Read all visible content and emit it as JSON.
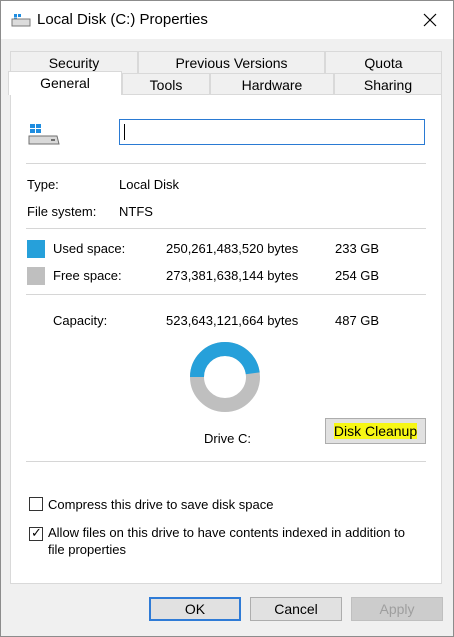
{
  "window": {
    "title": "Local Disk (C:) Properties"
  },
  "tabs": {
    "row_top": [
      "Security",
      "Previous Versions",
      "Quota"
    ],
    "row_bottom": [
      "General",
      "Tools",
      "Hardware",
      "Sharing"
    ],
    "active": "General"
  },
  "general": {
    "drive_label_value": "",
    "type_label": "Type:",
    "type_value": "Local Disk",
    "fs_label": "File system:",
    "fs_value": "NTFS",
    "used": {
      "label": "Used space:",
      "bytes": "250,261,483,520 bytes",
      "size": "233 GB",
      "color": "#26a0da"
    },
    "free": {
      "label": "Free space:",
      "bytes": "273,381,638,144 bytes",
      "size": "254 GB",
      "color": "#bfbfbf"
    },
    "capacity": {
      "label": "Capacity:",
      "bytes": "523,643,121,664 bytes",
      "size": "487 GB"
    },
    "usage_fraction": 0.478,
    "drive_caption": "Drive C:",
    "disk_cleanup_label": "Disk Cleanup",
    "compress_label": "Compress this drive to save disk space",
    "compress_checked": false,
    "index_label_line1": "Allow files on this drive to have contents indexed in addition to",
    "index_label_line2": "file properties",
    "index_checked": true
  },
  "footer": {
    "ok": "OK",
    "cancel": "Cancel",
    "apply": "Apply"
  },
  "icons": {
    "title": "drive-icon",
    "close": "close-icon",
    "drive": "windows-drive-icon"
  },
  "colors": {
    "accent": "#2f7bd6",
    "highlight": "#f7f715"
  }
}
